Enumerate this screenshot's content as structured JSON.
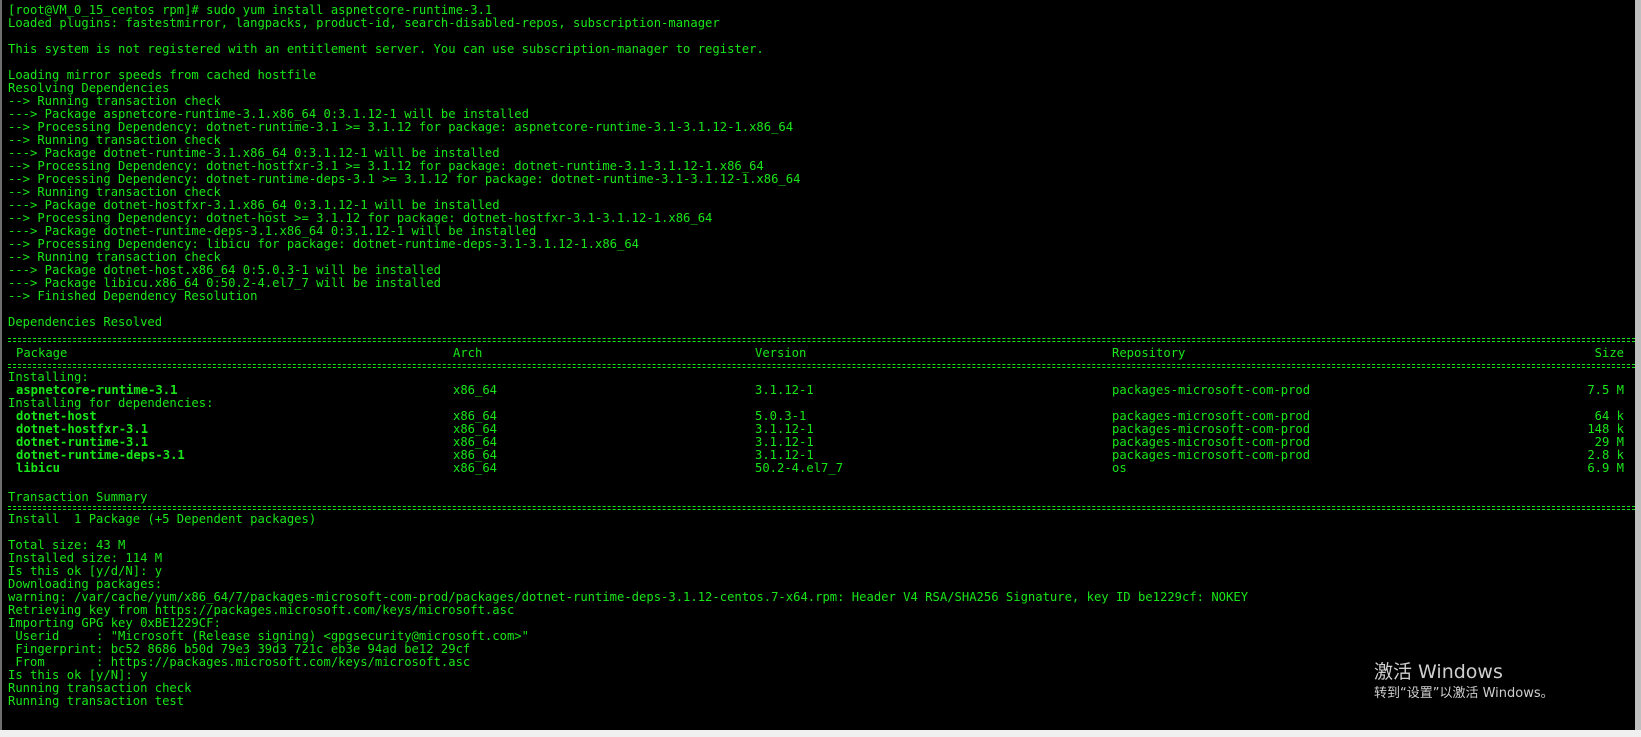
{
  "terminal": {
    "lines_top": [
      {
        "text": "[root@VM_0_15_centos rpm]# sudo yum install aspnetcore-runtime-3.1",
        "row": 0
      },
      {
        "text": "Loaded plugins: fastestmirror, langpacks, product-id, search-disabled-repos, subscription-manager",
        "row": 1
      },
      {
        "text": "This system is not registered with an entitlement server. You can use subscription-manager to register.",
        "row": 3
      },
      {
        "text": "Loading mirror speeds from cached hostfile",
        "row": 5
      },
      {
        "text": "Resolving Dependencies",
        "row": 6
      },
      {
        "text": "--> Running transaction check",
        "row": 7
      },
      {
        "text": "---> Package aspnetcore-runtime-3.1.x86_64 0:3.1.12-1 will be installed",
        "row": 8
      },
      {
        "text": "--> Processing Dependency: dotnet-runtime-3.1 >= 3.1.12 for package: aspnetcore-runtime-3.1-3.1.12-1.x86_64",
        "row": 9
      },
      {
        "text": "--> Running transaction check",
        "row": 10
      },
      {
        "text": "---> Package dotnet-runtime-3.1.x86_64 0:3.1.12-1 will be installed",
        "row": 11
      },
      {
        "text": "--> Processing Dependency: dotnet-hostfxr-3.1 >= 3.1.12 for package: dotnet-runtime-3.1-3.1.12-1.x86_64",
        "row": 12
      },
      {
        "text": "--> Processing Dependency: dotnet-runtime-deps-3.1 >= 3.1.12 for package: dotnet-runtime-3.1-3.1.12-1.x86_64",
        "row": 13
      },
      {
        "text": "--> Running transaction check",
        "row": 14
      },
      {
        "text": "---> Package dotnet-hostfxr-3.1.x86_64 0:3.1.12-1 will be installed",
        "row": 15
      },
      {
        "text": "--> Processing Dependency: dotnet-host >= 3.1.12 for package: dotnet-hostfxr-3.1-3.1.12-1.x86_64",
        "row": 16
      },
      {
        "text": "---> Package dotnet-runtime-deps-3.1.x86_64 0:3.1.12-1 will be installed",
        "row": 17
      },
      {
        "text": "--> Processing Dependency: libicu for package: dotnet-runtime-deps-3.1-3.1.12-1.x86_64",
        "row": 18
      },
      {
        "text": "--> Running transaction check",
        "row": 19
      },
      {
        "text": "---> Package dotnet-host.x86_64 0:5.0.3-1 will be installed",
        "row": 20
      },
      {
        "text": "---> Package libicu.x86_64 0:50.2-4.el7_7 will be installed",
        "row": 21
      },
      {
        "text": "--> Finished Dependency Resolution",
        "row": 22
      },
      {
        "text": "Dependencies Resolved",
        "row": 24
      }
    ],
    "table": {
      "headers": {
        "package": "Package",
        "arch": "Arch",
        "version": "Version",
        "repository": "Repository",
        "size": "Size"
      },
      "installing_label": "Installing:",
      "deps_label": "Installing for dependencies:",
      "installing": [
        {
          "package": "aspnetcore-runtime-3.1",
          "arch": "x86_64",
          "version": "3.1.12-1",
          "repository": "packages-microsoft-com-prod",
          "size": "7.5 M"
        }
      ],
      "dependencies": [
        {
          "package": "dotnet-host",
          "arch": "x86_64",
          "version": "5.0.3-1",
          "repository": "packages-microsoft-com-prod",
          "size": "64 k"
        },
        {
          "package": "dotnet-hostfxr-3.1",
          "arch": "x86_64",
          "version": "3.1.12-1",
          "repository": "packages-microsoft-com-prod",
          "size": "148 k"
        },
        {
          "package": "dotnet-runtime-3.1",
          "arch": "x86_64",
          "version": "3.1.12-1",
          "repository": "packages-microsoft-com-prod",
          "size": "29 M"
        },
        {
          "package": "dotnet-runtime-deps-3.1",
          "arch": "x86_64",
          "version": "3.1.12-1",
          "repository": "packages-microsoft-com-prod",
          "size": "2.8 k"
        },
        {
          "package": "libicu",
          "arch": "x86_64",
          "version": "50.2-4.el7_7",
          "repository": "os",
          "size": "6.9 M"
        }
      ]
    },
    "transaction_summary": "Transaction Summary",
    "install_summary": "Install  1 Package (+5 Dependent packages)",
    "lines_bottom": [
      "Total size: 43 M",
      "Installed size: 114 M",
      "Is this ok [y/d/N]: y",
      "Downloading packages:",
      "warning: /var/cache/yum/x86_64/7/packages-microsoft-com-prod/packages/dotnet-runtime-deps-3.1.12-centos.7-x64.rpm: Header V4 RSA/SHA256 Signature, key ID be1229cf: NOKEY",
      "Retrieving key from https://packages.microsoft.com/keys/microsoft.asc",
      "Importing GPG key 0xBE1229CF:",
      " Userid     : \"Microsoft (Release signing) <gpgsecurity@microsoft.com>\"",
      " Fingerprint: bc52 8686 b50d 79e3 39d3 721c eb3e 94ad be12 29cf",
      " From       : https://packages.microsoft.com/keys/microsoft.asc",
      "Is this ok [y/N]: y",
      "Running transaction check",
      "Running transaction test"
    ]
  },
  "watermark": {
    "title": "激活 Windows",
    "subtitle": "转到“设置”以激活 Windows。"
  },
  "colors": {
    "terminal_bg": "#000000",
    "terminal_fg": "#19e619",
    "watermark": "#cfcfcf"
  }
}
